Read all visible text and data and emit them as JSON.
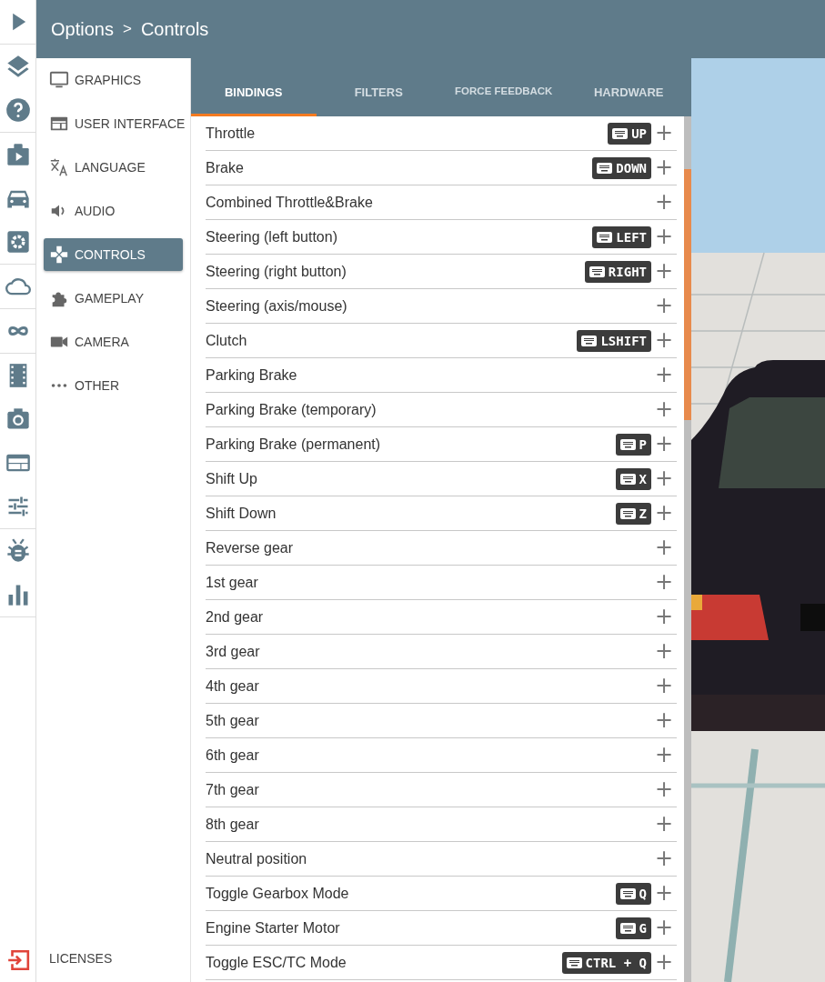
{
  "header": {
    "title": "Options",
    "separator": ">",
    "page": "Controls"
  },
  "sidebar": {
    "items": [
      {
        "label": "GRAPHICS",
        "selected": false
      },
      {
        "label": "USER INTERFACE",
        "selected": false
      },
      {
        "label": "LANGUAGE",
        "selected": false
      },
      {
        "label": "AUDIO",
        "selected": false
      },
      {
        "label": "CONTROLS",
        "selected": true
      },
      {
        "label": "GAMEPLAY",
        "selected": false
      },
      {
        "label": "CAMERA",
        "selected": false
      },
      {
        "label": "OTHER",
        "selected": false
      }
    ],
    "footer": "LICENSES"
  },
  "tabs": [
    {
      "label": "BINDINGS",
      "selected": true
    },
    {
      "label": "FILTERS",
      "selected": false
    },
    {
      "label": "FORCE FEEDBACK",
      "selected": false
    },
    {
      "label": "HARDWARE",
      "selected": false
    }
  ],
  "bindings": [
    {
      "action": "Throttle",
      "key": "UP"
    },
    {
      "action": "Brake",
      "key": "DOWN"
    },
    {
      "action": "Combined Throttle&Brake"
    },
    {
      "action": "Steering (left button)",
      "key": "LEFT"
    },
    {
      "action": "Steering (right button)",
      "key": "RIGHT"
    },
    {
      "action": "Steering (axis/mouse)"
    },
    {
      "action": "Clutch",
      "key": "LSHIFT"
    },
    {
      "action": "Parking Brake"
    },
    {
      "action": "Parking Brake (temporary)"
    },
    {
      "action": "Parking Brake (permanent)",
      "key": "P"
    },
    {
      "action": "Shift Up",
      "key": "X"
    },
    {
      "action": "Shift Down",
      "key": "Z"
    },
    {
      "action": "Reverse gear"
    },
    {
      "action": "1st gear"
    },
    {
      "action": "2nd gear"
    },
    {
      "action": "3rd gear"
    },
    {
      "action": "4th gear"
    },
    {
      "action": "5th gear"
    },
    {
      "action": "6th gear"
    },
    {
      "action": "7th gear"
    },
    {
      "action": "8th gear"
    },
    {
      "action": "Neutral position"
    },
    {
      "action": "Toggle Gearbox Mode",
      "key": "Q"
    },
    {
      "action": "Engine Starter Motor",
      "key": "G"
    },
    {
      "action": "Toggle ESC/TC Mode",
      "key": "CTRL + Q"
    }
  ],
  "add_symbol": "+"
}
